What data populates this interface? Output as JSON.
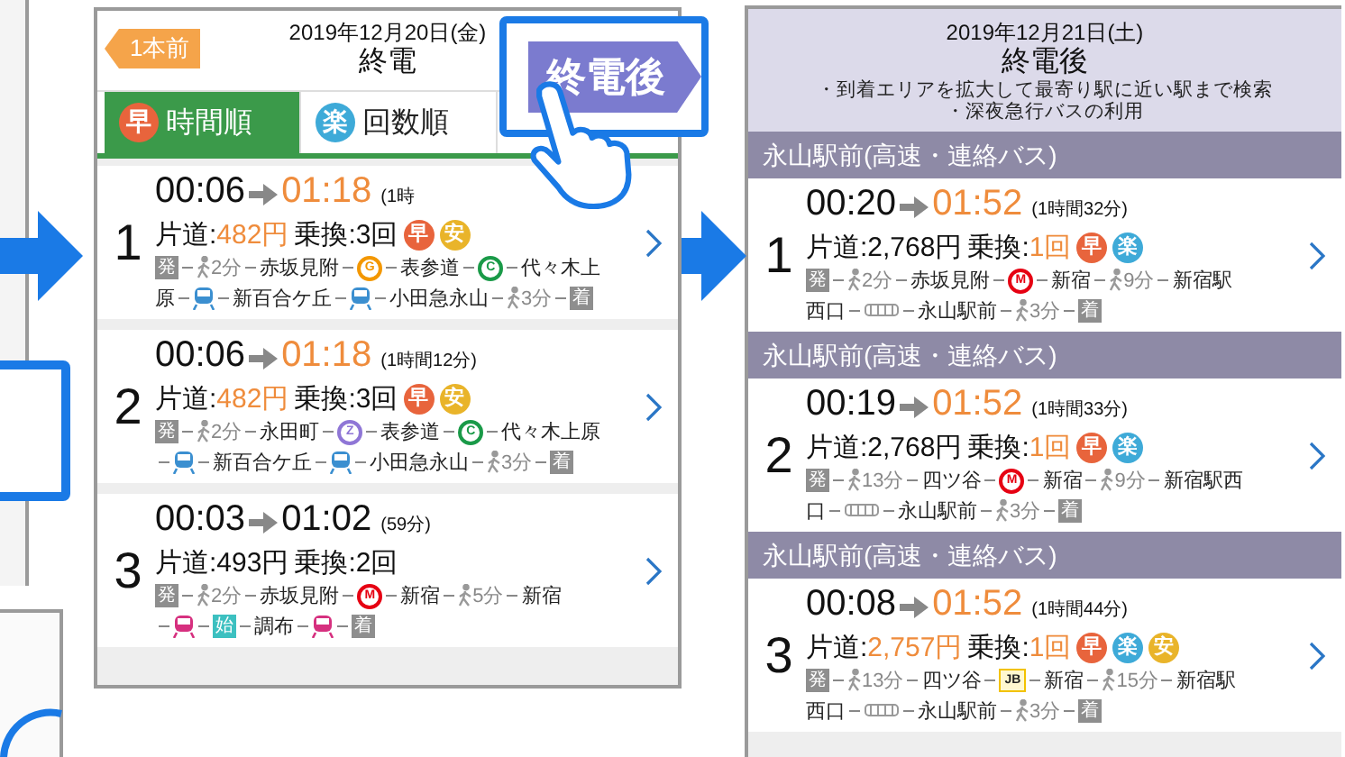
{
  "before_screen": {
    "back_button": "1本前",
    "date": "2019年12月20日(金)",
    "title": "終電",
    "tabs": [
      {
        "badge": "早",
        "color": "#e8643c",
        "label": "時間順",
        "selected": true
      },
      {
        "badge": "楽",
        "color": "#3eaad8",
        "label": "回数順",
        "selected": false
      }
    ],
    "next_button": "終電後",
    "routes": [
      {
        "number": "1",
        "departure": "00:06",
        "arrival": "01:18",
        "arrival_highlight": true,
        "duration": "(1時",
        "fare_label": "片道:",
        "fare": "482円",
        "fare_highlight": true,
        "transfer_label": "乗換:",
        "transfers": "3回",
        "transfers_highlight": false,
        "badges": [
          {
            "text": "早",
            "color": "#e8643c"
          },
          {
            "text": "安",
            "color": "#e9b42a"
          }
        ],
        "steps": [
          [
            {
              "kind": "mark",
              "text": "発",
              "color": "#8e8e8e"
            },
            {
              "kind": "walk",
              "text": "2分"
            },
            {
              "kind": "station",
              "text": "赤坂見附"
            },
            {
              "kind": "line",
              "text": "G",
              "color": "#f39700"
            },
            {
              "kind": "station",
              "text": "表参道"
            },
            {
              "kind": "line",
              "text": "C",
              "color": "#1a9a48"
            },
            {
              "kind": "station",
              "text": "代々木上"
            }
          ],
          [
            {
              "kind": "station_end",
              "text": "原"
            },
            {
              "kind": "train",
              "color": "#3b8fd0"
            },
            {
              "kind": "station",
              "text": "新百合ケ丘"
            },
            {
              "kind": "train",
              "color": "#3b8fd0"
            },
            {
              "kind": "station",
              "text": "小田急永山"
            },
            {
              "kind": "walk",
              "text": "3分"
            },
            {
              "kind": "mark",
              "text": "着",
              "color": "#8e8e8e"
            }
          ]
        ]
      },
      {
        "number": "2",
        "departure": "00:06",
        "arrival": "01:18",
        "arrival_highlight": true,
        "duration": "(1時間12分)",
        "fare_label": "片道:",
        "fare": "482円",
        "fare_highlight": true,
        "transfer_label": "乗換:",
        "transfers": "3回",
        "transfers_highlight": false,
        "badges": [
          {
            "text": "早",
            "color": "#e8643c"
          },
          {
            "text": "安",
            "color": "#e9b42a"
          }
        ],
        "steps": [
          [
            {
              "kind": "mark",
              "text": "発",
              "color": "#8e8e8e"
            },
            {
              "kind": "walk",
              "text": "2分"
            },
            {
              "kind": "station",
              "text": "永田町"
            },
            {
              "kind": "line",
              "text": "Z",
              "color": "#8f76d6"
            },
            {
              "kind": "station",
              "text": "表参道"
            },
            {
              "kind": "line",
              "text": "C",
              "color": "#1a9a48"
            },
            {
              "kind": "station",
              "text": "代々木上原"
            }
          ],
          [
            {
              "kind": "train",
              "color": "#3b8fd0"
            },
            {
              "kind": "station",
              "text": "新百合ケ丘"
            },
            {
              "kind": "train",
              "color": "#3b8fd0"
            },
            {
              "kind": "station",
              "text": "小田急永山"
            },
            {
              "kind": "walk",
              "text": "3分"
            },
            {
              "kind": "mark",
              "text": "着",
              "color": "#8e8e8e"
            }
          ]
        ]
      },
      {
        "number": "3",
        "departure": "00:03",
        "arrival": "01:02",
        "arrival_highlight": false,
        "duration": "(59分)",
        "fare_label": "片道:",
        "fare": "493円",
        "fare_highlight": false,
        "transfer_label": "乗換:",
        "transfers": "2回",
        "transfers_highlight": false,
        "steps": [
          [
            {
              "kind": "mark",
              "text": "発",
              "color": "#8e8e8e"
            },
            {
              "kind": "walk",
              "text": "2分"
            },
            {
              "kind": "station",
              "text": "赤坂見附"
            },
            {
              "kind": "line",
              "text": "M",
              "color": "#e60012"
            },
            {
              "kind": "station",
              "text": "新宿"
            },
            {
              "kind": "walk",
              "text": "5分"
            },
            {
              "kind": "station",
              "text": "新宿"
            }
          ],
          [
            {
              "kind": "train",
              "color": "#d6307f"
            },
            {
              "kind": "mark",
              "text": "始",
              "color": "#3cc0c0"
            },
            {
              "kind": "station",
              "text": "調布"
            },
            {
              "kind": "train",
              "color": "#d6307f"
            },
            {
              "kind": "mark",
              "text": "着",
              "color": "#8e8e8e"
            }
          ]
        ]
      }
    ]
  },
  "after_screen": {
    "date": "2019年12月21日(土)",
    "title": "終電後",
    "notes": [
      "・到着エリアを拡大して最寄り駅に近い駅まで検索",
      "・深夜急行バスの利用"
    ],
    "routes": [
      {
        "section": "永山駅前(高速・連絡バス)",
        "number": "1",
        "departure": "00:20",
        "arrival": "01:52",
        "arrival_highlight": true,
        "duration": "(1時間32分)",
        "fare_label": "片道:",
        "fare": "2,768円",
        "fare_highlight": false,
        "transfer_label": "乗換:",
        "transfers": "1回",
        "transfers_highlight": true,
        "badges": [
          {
            "text": "早",
            "color": "#e8643c"
          },
          {
            "text": "楽",
            "color": "#3eaad8"
          }
        ],
        "steps": [
          [
            {
              "kind": "mark",
              "text": "発",
              "color": "#8e8e8e"
            },
            {
              "kind": "walk",
              "text": "2分"
            },
            {
              "kind": "station",
              "text": "赤坂見附"
            },
            {
              "kind": "line",
              "text": "M",
              "color": "#e60012"
            },
            {
              "kind": "station",
              "text": "新宿"
            },
            {
              "kind": "walk",
              "text": "9分"
            },
            {
              "kind": "station",
              "text": "新宿駅"
            }
          ],
          [
            {
              "kind": "station_end",
              "text": "西口"
            },
            {
              "kind": "bus"
            },
            {
              "kind": "station",
              "text": "永山駅前"
            },
            {
              "kind": "walk",
              "text": "3分"
            },
            {
              "kind": "mark",
              "text": "着",
              "color": "#8e8e8e"
            }
          ]
        ]
      },
      {
        "section": "永山駅前(高速・連絡バス)",
        "number": "2",
        "departure": "00:19",
        "arrival": "01:52",
        "arrival_highlight": true,
        "duration": "(1時間33分)",
        "fare_label": "片道:",
        "fare": "2,768円",
        "fare_highlight": false,
        "transfer_label": "乗換:",
        "transfers": "1回",
        "transfers_highlight": true,
        "badges": [
          {
            "text": "早",
            "color": "#e8643c"
          },
          {
            "text": "楽",
            "color": "#3eaad8"
          }
        ],
        "steps": [
          [
            {
              "kind": "mark",
              "text": "発",
              "color": "#8e8e8e"
            },
            {
              "kind": "walk",
              "text": "13分"
            },
            {
              "kind": "station",
              "text": "四ツ谷"
            },
            {
              "kind": "line",
              "text": "M",
              "color": "#e60012"
            },
            {
              "kind": "station",
              "text": "新宿"
            },
            {
              "kind": "walk",
              "text": "9分"
            },
            {
              "kind": "station",
              "text": "新宿駅西"
            }
          ],
          [
            {
              "kind": "station_end",
              "text": "口"
            },
            {
              "kind": "bus"
            },
            {
              "kind": "station",
              "text": "永山駅前"
            },
            {
              "kind": "walk",
              "text": "3分"
            },
            {
              "kind": "mark",
              "text": "着",
              "color": "#8e8e8e"
            }
          ]
        ]
      },
      {
        "section": "永山駅前(高速・連絡バス)",
        "number": "3",
        "departure": "00:08",
        "arrival": "01:52",
        "arrival_highlight": true,
        "duration": "(1時間44分)",
        "fare_label": "片道:",
        "fare": "2,757円",
        "fare_highlight": true,
        "transfer_label": "乗換:",
        "transfers": "1回",
        "transfers_highlight": true,
        "badges": [
          {
            "text": "早",
            "color": "#e8643c"
          },
          {
            "text": "楽",
            "color": "#3eaad8"
          },
          {
            "text": "安",
            "color": "#e9b42a"
          }
        ],
        "steps": [
          [
            {
              "kind": "mark",
              "text": "発",
              "color": "#8e8e8e"
            },
            {
              "kind": "walk",
              "text": "13分"
            },
            {
              "kind": "station",
              "text": "四ツ谷"
            },
            {
              "kind": "square_line",
              "text": "JB",
              "color": "#f2c200"
            },
            {
              "kind": "station",
              "text": "新宿"
            },
            {
              "kind": "walk",
              "text": "15分"
            },
            {
              "kind": "station",
              "text": "新宿駅"
            }
          ],
          [
            {
              "kind": "station_end",
              "text": "西口"
            },
            {
              "kind": "bus"
            },
            {
              "kind": "station",
              "text": "永山駅前"
            },
            {
              "kind": "walk",
              "text": "3分"
            },
            {
              "kind": "mark",
              "text": "着",
              "color": "#8e8e8e"
            }
          ]
        ]
      }
    ]
  }
}
